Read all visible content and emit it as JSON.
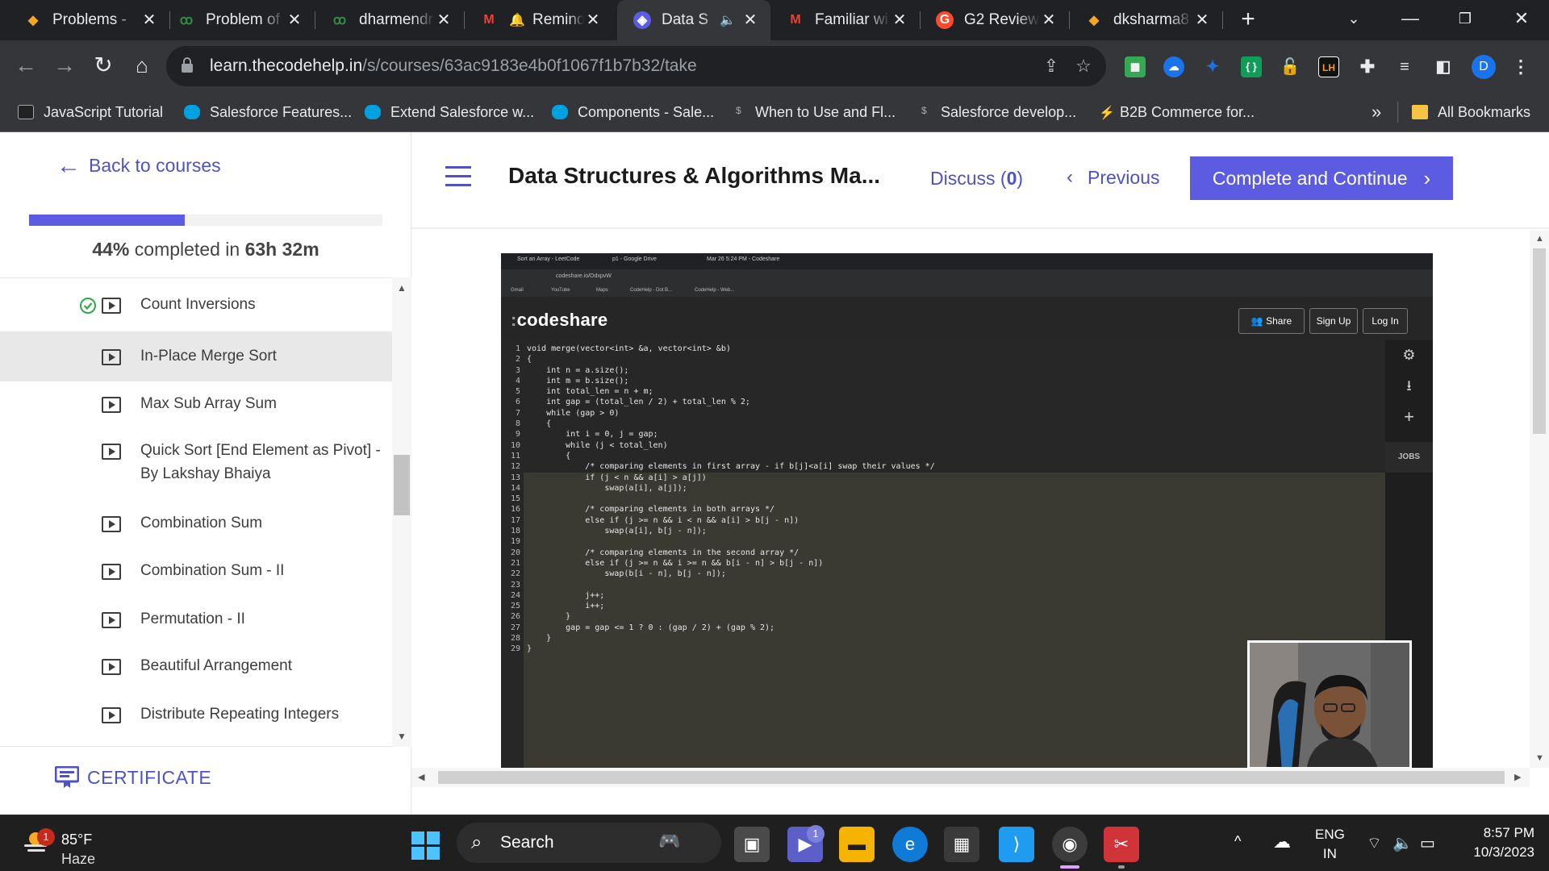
{
  "browser": {
    "tabs": [
      {
        "title": "Problems - ",
        "icon": "codehelp-icon"
      },
      {
        "title": "Problem of ",
        "icon": "gfg-icon"
      },
      {
        "title": "dharmendra",
        "icon": "gfg-icon"
      },
      {
        "title": "Reminder",
        "icon": "gmail-icon"
      },
      {
        "title": "Data S",
        "icon": "codehelp-icon",
        "active": true
      },
      {
        "title": "Familiar wi",
        "icon": "gmail-icon"
      },
      {
        "title": "G2 Review",
        "icon": "g2-icon"
      },
      {
        "title": "dksharma8",
        "icon": "codehelp-icon"
      }
    ],
    "url_domain": "learn.thecodehelp.in",
    "url_path": "/s/courses/63ac9183e4b0f1067f1b7b32/take",
    "profile_initial": "D",
    "bookmarks": [
      "JavaScript Tutorial",
      "Salesforce Features...",
      "Extend Salesforce w...",
      "Components - Sale...",
      "When to Use and Fl...",
      "Salesforce develop...",
      "B2B Commerce for..."
    ],
    "bookmarks_more": "»",
    "all_bookmarks": "All Bookmarks"
  },
  "sidebar": {
    "back_label": "Back to courses",
    "progress_percent": 44,
    "progress_pct_text": "44%",
    "progress_mid_text": "completed in",
    "progress_time": "63h 32m",
    "lessons": [
      {
        "label": "Count Inversions",
        "completed": true
      },
      {
        "label": "In-Place Merge Sort",
        "active": true
      },
      {
        "label": "Max Sub Array Sum"
      },
      {
        "label": "Quick Sort [End Element as Pivot] - By Lakshay Bhaiya"
      },
      {
        "label": "Combination Sum"
      },
      {
        "label": "Combination Sum - II"
      },
      {
        "label": "Permutation - II"
      },
      {
        "label": "Beautiful Arrangement"
      },
      {
        "label": "Distribute Repeating Integers"
      }
    ],
    "certificate_label": "CERTIFICATE"
  },
  "header": {
    "course_title": "Data Structures & Algorithms Ma...",
    "discuss_label": "Discuss (",
    "discuss_count": "0",
    "discuss_close": ")",
    "previous_label": "Previous",
    "complete_label": "Complete and Continue"
  },
  "video": {
    "inner_tabs": [
      "Sort an Array - LeetCode",
      "p1 - Google Drive",
      "Mar 26 5:24 PM - Codeshare"
    ],
    "inner_url": "codeshare.io/OdxpvW",
    "inner_bookmarks": [
      "Gmail",
      "YouTube",
      "Maps",
      "CodeHelp - Dot B...",
      "CodeHelp - Web..."
    ],
    "site_logo": "codeshare",
    "buttons": [
      "Share",
      "Sign Up",
      "Log In"
    ],
    "jobs_label": "JOBS",
    "code_lines": [
      "void merge(vector<int> &a, vector<int> &b)",
      "{",
      "    int n = a.size();",
      "    int m = b.size();",
      "    int total_len = n + m;",
      "    int gap = (total_len / 2) + total_len % 2;",
      "    while (gap > 0)",
      "    {",
      "        int i = 0, j = gap;",
      "        while (j < total_len)",
      "        {",
      "            /* comparing elements in first array - if b[j]<a[i] swap their values */",
      "            if (j < n && a[i] > a[j])",
      "                swap(a[i], a[j]);",
      "",
      "            /* comparing elements in both arrays */",
      "            else if (j >= n && i < n && a[i] > b[j - n])",
      "                swap(a[i], b[j - n]);",
      "",
      "            /* comparing elements in the second array */",
      "            else if (j >= n && i >= n && b[i - n] > b[j - n])",
      "                swap(b[i - n], b[j - n]);",
      "",
      "            j++;",
      "            i++;",
      "        }",
      "        gap = gap <= 1 ? 0 : (gap / 2) + (gap % 2);",
      "    }",
      "}"
    ]
  },
  "taskbar": {
    "weather_temp": "85°F",
    "weather_cond": "Haze",
    "weather_badge": "1",
    "search_label": "Search",
    "teams_badge": "1",
    "lang": "ENG",
    "region": "IN",
    "time": "8:57 PM",
    "date": "10/3/2023"
  },
  "colors": {
    "accent": "#5b5ce2",
    "link": "#4f51c9",
    "chrome_dark": "#202124",
    "chrome_toolbar": "#35363a"
  }
}
